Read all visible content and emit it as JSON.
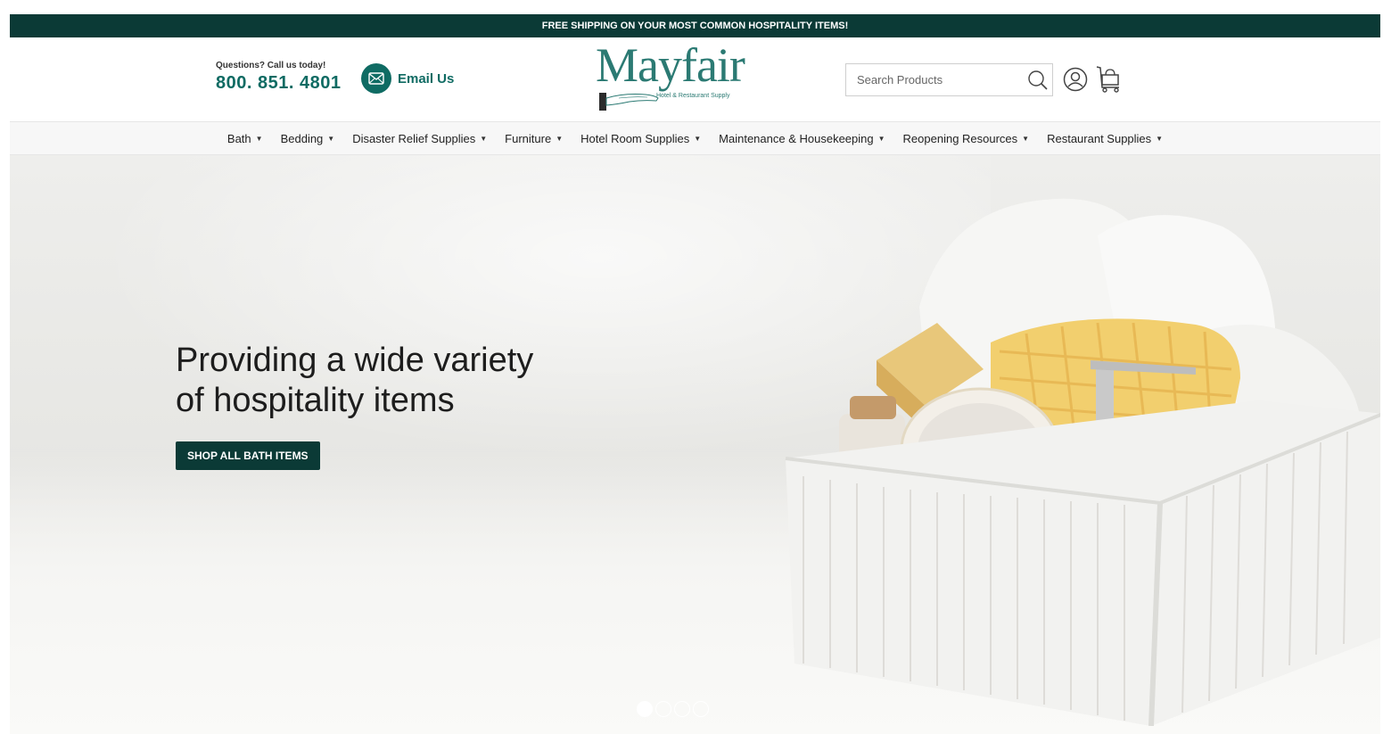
{
  "promo": {
    "text": "FREE SHIPPING ON YOUR MOST COMMON HOSPITALITY ITEMS!"
  },
  "header": {
    "question": "Questions? Call us today!",
    "phone": "800. 851. 4801",
    "email_label": "Email Us",
    "logo_text": "Mayfair",
    "logo_sub": "Hotel & Restaurant Supply",
    "search_placeholder": "Search Products"
  },
  "nav": {
    "items": [
      {
        "label": "Bath"
      },
      {
        "label": "Bedding"
      },
      {
        "label": "Disaster Relief Supplies"
      },
      {
        "label": "Furniture"
      },
      {
        "label": "Hotel Room Supplies"
      },
      {
        "label": "Maintenance & Housekeeping"
      },
      {
        "label": "Reopening Resources"
      },
      {
        "label": "Restaurant Supplies"
      }
    ]
  },
  "hero": {
    "title_line1": "Providing a wide variety",
    "title_line2": "of hospitality items",
    "button": "SHOP ALL BATH ITEMS",
    "slides": 4,
    "active_slide": 1
  },
  "colors": {
    "brand_dark": "#0b3a36",
    "brand_teal": "#0f6b63"
  }
}
